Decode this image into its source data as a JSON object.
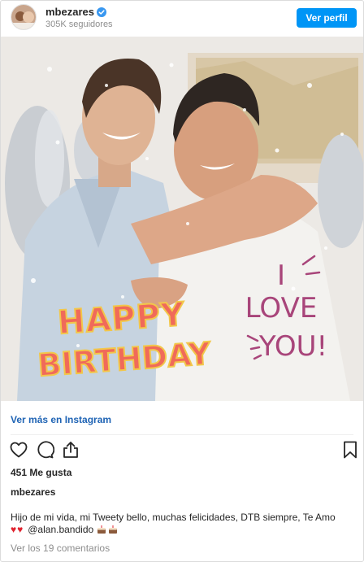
{
  "header": {
    "username": "mbezares",
    "followers": "305K seguidores",
    "view_profile_label": "Ver perfil",
    "verified_icon": "verified-badge-icon",
    "accent_color": "#0095f6"
  },
  "photo": {
    "overlay_left": "HAPPY BIRTHDAY",
    "overlay_right_line1": "I",
    "overlay_right_line2": "LOVE",
    "overlay_right_line3": "YOU!"
  },
  "footer": {
    "see_more_label": "Ver más en Instagram",
    "actions": {
      "like_icon": "heart-icon",
      "comment_icon": "comment-icon",
      "share_icon": "share-icon",
      "save_icon": "bookmark-icon"
    },
    "likes": "451 Me gusta",
    "caption_user": "mbezares",
    "caption_text": "Hijo de mi vida, mi Tweety bello, muchas felicidades, DTB siempre, Te Amo",
    "caption_hearts": "♥♥",
    "caption_mention": "@alan.bandido",
    "view_comments": "Ver los 19 comentarios"
  }
}
